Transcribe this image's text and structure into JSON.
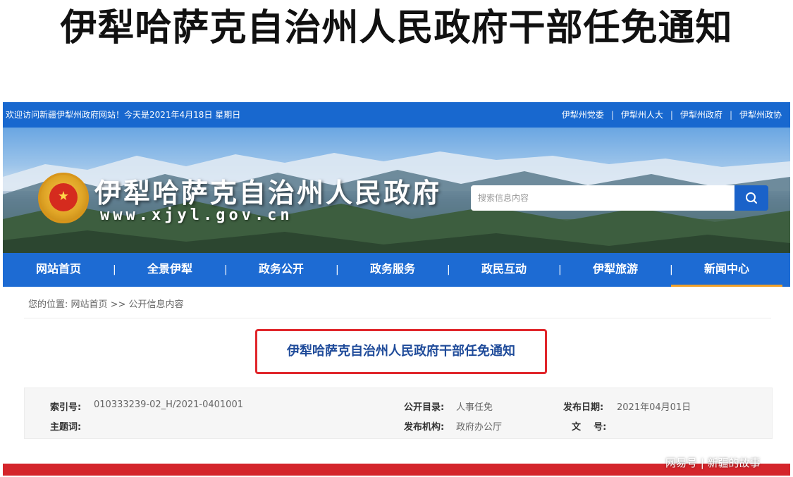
{
  "headline": "伊犁哈萨克自治州人民政府干部任免通知",
  "topbar": {
    "welcome": "欢迎访问新疆伊犁州政府网站！今天是2021年4月18日  星期日",
    "links": [
      "伊犁州党委",
      "伊犁州人大",
      "伊犁州政府",
      "伊犁州政协"
    ],
    "separator": "|"
  },
  "banner": {
    "site_title": "伊犁哈萨克自治州人民政府",
    "site_url": "www.xjyl.gov.cn",
    "search_placeholder": "搜索信息内容"
  },
  "nav": {
    "items": [
      "网站首页",
      "全景伊犁",
      "政务公开",
      "政务服务",
      "政民互动",
      "伊犁旅游",
      "新闻中心"
    ],
    "active_index": 6
  },
  "breadcrumb": "您的位置: 网站首页 >> 公开信息内容",
  "article": {
    "title": "伊犁哈萨克自治州人民政府干部任免通知"
  },
  "meta": {
    "index_label": "索引号:",
    "index_value": "010333239-02_H/2021-0401001",
    "catalog_label": "公开目录:",
    "catalog_value": "人事任免",
    "date_label": "发布日期:",
    "date_value": "2021年04月01日",
    "subject_label": "主题词:",
    "issuer_label": "发布机构:",
    "issuer_value": "政府办公厅",
    "docno_label": "文    号:"
  },
  "watermark": "网易号 | 新疆的故事",
  "colors": {
    "topbar": "#1868cf",
    "nav": "#1d6bd3",
    "nav_active_underline": "#f0a02a",
    "highlight_border": "#e0262b",
    "article_title": "#1f4b9a",
    "footer_bar": "#d4252b"
  }
}
